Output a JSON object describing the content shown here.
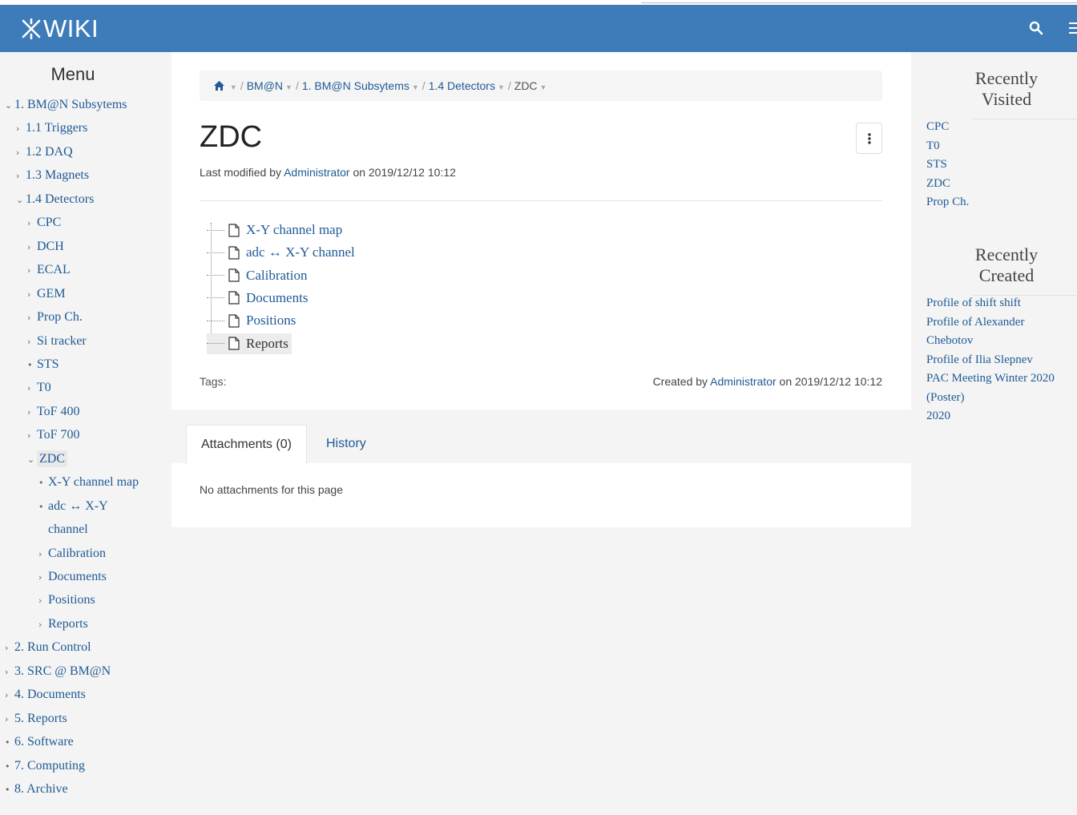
{
  "header": {
    "logo": "WIKI"
  },
  "menu": {
    "title": "Menu",
    "items": [
      {
        "marker": "⌄",
        "label": "1. BM@N Subsytems"
      },
      {
        "marker": "›",
        "label": "1.1 Triggers"
      },
      {
        "marker": "›",
        "label": "1.2 DAQ"
      },
      {
        "marker": "›",
        "label": "1.3 Magnets"
      },
      {
        "marker": "⌄",
        "label": "1.4 Detectors"
      },
      {
        "marker": "›",
        "label": "CPC"
      },
      {
        "marker": "›",
        "label": "DCH"
      },
      {
        "marker": "›",
        "label": "ECAL"
      },
      {
        "marker": "›",
        "label": "GEM"
      },
      {
        "marker": "›",
        "label": "Prop Ch."
      },
      {
        "marker": "›",
        "label": "Si tracker"
      },
      {
        "marker": "•",
        "label": "STS"
      },
      {
        "marker": "›",
        "label": "T0"
      },
      {
        "marker": "›",
        "label": "ToF 400"
      },
      {
        "marker": "›",
        "label": "ToF 700"
      },
      {
        "marker": "⌄",
        "label": "ZDC"
      },
      {
        "marker": "•",
        "label": "X-Y channel map"
      },
      {
        "marker": "•",
        "label": "adc ↔ X-Y"
      },
      {
        "marker": "",
        "label": "channel"
      },
      {
        "marker": "›",
        "label": "Calibration"
      },
      {
        "marker": "›",
        "label": "Documents"
      },
      {
        "marker": "›",
        "label": "Positions"
      },
      {
        "marker": "›",
        "label": "Reports"
      },
      {
        "marker": "›",
        "label": "2. Run Control"
      },
      {
        "marker": "›",
        "label": "3. SRC @ BM@N"
      },
      {
        "marker": "›",
        "label": "4. Documents"
      },
      {
        "marker": "›",
        "label": "5. Reports"
      },
      {
        "marker": "•",
        "label": "6. Software"
      },
      {
        "marker": "•",
        "label": "7. Computing"
      },
      {
        "marker": "•",
        "label": "8. Archive"
      }
    ]
  },
  "breadcrumb": {
    "items": [
      "BM@N",
      "1. BM@N Subsytems",
      "1.4 Detectors",
      "ZDC"
    ]
  },
  "page": {
    "title": "ZDC",
    "last_modified_prefix": "Last modified by",
    "last_modified_author": "Administrator",
    "last_modified_date": "on 2019/12/12 10:12",
    "children": [
      "X-Y channel map",
      "adc ↔ X-Y channel",
      "Calibration",
      "Documents",
      "Positions",
      "Reports"
    ],
    "tags_label": "Tags:",
    "created_prefix": "Created by",
    "created_author": "Administrator",
    "created_date": "on 2019/12/12 10:12"
  },
  "tabs": {
    "attachments": "Attachments (0)",
    "history": "History",
    "no_attachments": "No attachments for this page"
  },
  "recently_visited": {
    "title_line1": "Recently",
    "title_line2": "Visited",
    "items": [
      "CPC",
      "T0",
      "STS",
      "ZDC",
      "Prop Ch."
    ]
  },
  "recently_created": {
    "title_line1": "Recently",
    "title_line2": "Created",
    "items": [
      "Profile of shift shift",
      "Profile of Alexander",
      "Chebotov",
      "Profile of Ilia Slepnev",
      "PAC Meeting Winter 2020",
      "(Poster)",
      "2020"
    ]
  },
  "colors": {
    "navbar": "#3e7cb9",
    "link": "#1f5a96"
  }
}
